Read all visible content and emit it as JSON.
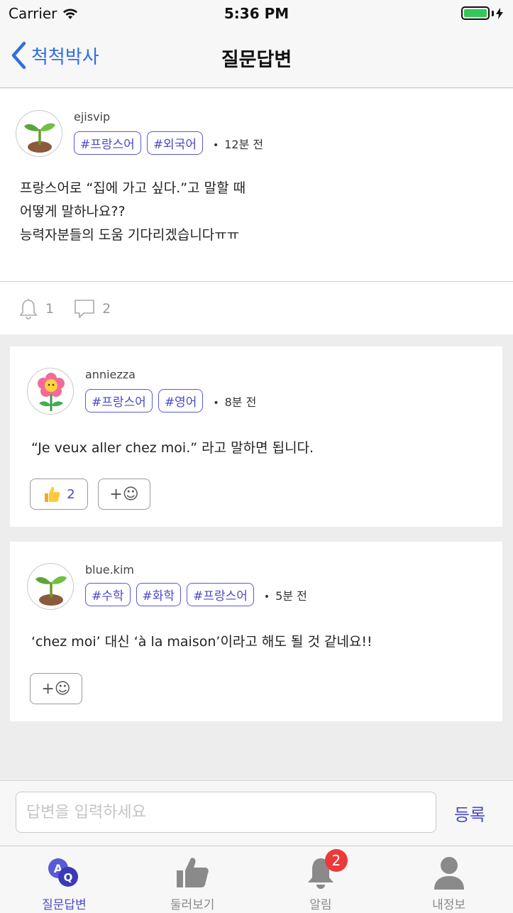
{
  "status_bar": {
    "carrier": "Carrier",
    "time": "5:36 PM"
  },
  "nav": {
    "back_label": "척척박사",
    "title": "질문답변"
  },
  "question": {
    "username": "ejisvip",
    "tags": [
      "#프랑스어",
      "#외국어"
    ],
    "time": "12분 전",
    "body_lines": [
      "프랑스어로 “집에 가고 싶다.”고 말할 때",
      "어떻게 말하나요??",
      "능력자분들의 도움 기다리겠습니다ㅠㅠ"
    ],
    "notify_count": "1",
    "comment_count": "2"
  },
  "answers": [
    {
      "username": "anniezza",
      "tags": [
        "#프랑스어",
        "#영어"
      ],
      "time": "8분 전",
      "body": "“Je veux aller chez moi.” 라고 말하면 됩니다.",
      "like_count": "2",
      "add_reaction": "+☺"
    },
    {
      "username": "blue.kim",
      "tags": [
        "#수학",
        "#화학",
        "#프랑스어"
      ],
      "time": "5분 전",
      "body": "‘chez moi’ 대신 ‘à la maison’이라고 해도 될 것 같네요!!",
      "add_reaction": "+☺"
    }
  ],
  "input": {
    "placeholder": "답변을 입력하세요",
    "submit_label": "등록"
  },
  "tabs": [
    {
      "label": "질문답변",
      "icon": "qa-icon"
    },
    {
      "label": "둘러보기",
      "icon": "thumbs-up-icon"
    },
    {
      "label": "알림",
      "icon": "bell-icon",
      "badge": "2"
    },
    {
      "label": "내정보",
      "icon": "person-icon"
    }
  ],
  "colors": {
    "accent": "#4a4ac8",
    "link": "#2f6fe0",
    "badge": "#ea3a3a",
    "battery": "#34c759"
  }
}
